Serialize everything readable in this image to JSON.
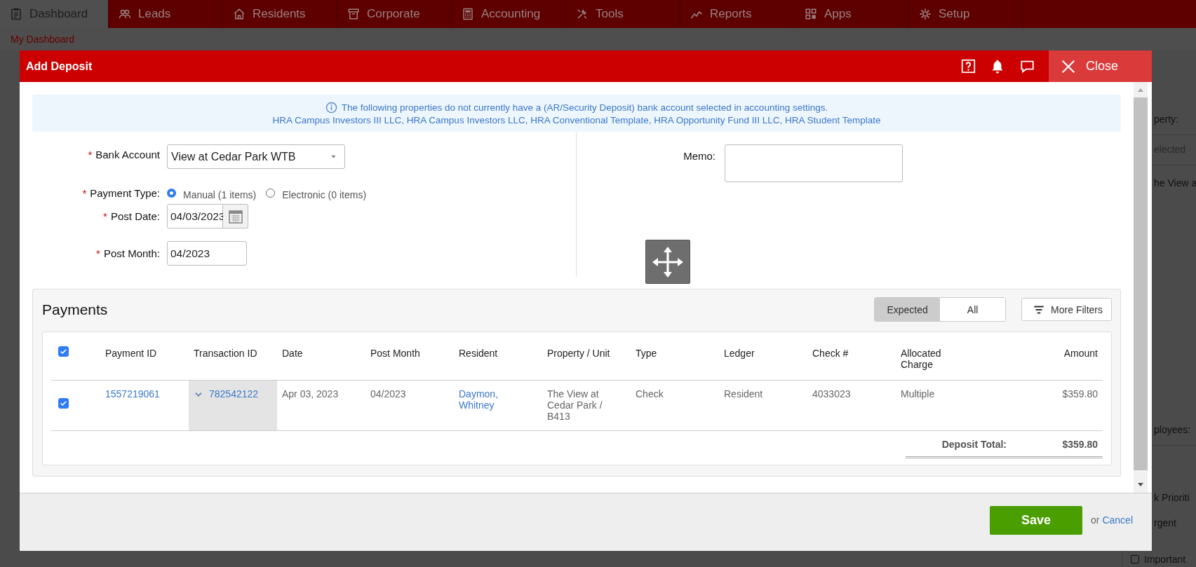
{
  "nav": {
    "tabs": [
      {
        "label": "Dashboard",
        "selected": true
      },
      {
        "label": "Leads",
        "selected": false
      },
      {
        "label": "Residents",
        "selected": false
      },
      {
        "label": "Corporate",
        "selected": false
      },
      {
        "label": "Accounting",
        "selected": false
      },
      {
        "label": "Tools",
        "selected": false
      },
      {
        "label": "Reports",
        "selected": false
      },
      {
        "label": "Apps",
        "selected": false
      },
      {
        "label": "Setup",
        "selected": false
      }
    ]
  },
  "breadcrumb": "My Dashboard",
  "background_panel": {
    "texts": [
      "perty:",
      "elected",
      "he View a",
      "ployees:",
      "k Prioriti",
      "rgent"
    ],
    "checkbox": {
      "label": "Important",
      "checked": false
    }
  },
  "dialog": {
    "title": "Add Deposit",
    "close_label": "Close",
    "notice": [
      "The following properties do not currently have a (AR/Security Deposit) bank account selected in accounting settings.",
      "HRA Campus Investors III LLC, HRA Campus Investors LLC, HRA Conventional Template, HRA Opportunity Fund III LLC, HRA Student Template"
    ],
    "form": {
      "bank_account": {
        "mark": "*",
        "label": "Bank Account",
        "value": "View at Cedar Park WTB"
      },
      "payment_type": {
        "mark": "*",
        "label": "Payment Type:",
        "options": [
          {
            "label": "Manual (1 items)",
            "selected": true
          },
          {
            "label": "Electronic (0 items)",
            "selected": false
          }
        ]
      },
      "post_date": {
        "mark": "*",
        "label": "Post Date:",
        "value": "04/03/2023"
      },
      "post_month": {
        "mark": "*",
        "label": "Post Month:",
        "value": "04/2023"
      },
      "memo": {
        "label": "Memo:"
      }
    },
    "payments": {
      "title": "Payments",
      "view_toggle": [
        {
          "label": "Expected",
          "selected": true
        },
        {
          "label": "All",
          "selected": false
        }
      ],
      "filters_button": "More Filters",
      "all_checked": true,
      "columns": [
        "Payment ID",
        "Transaction ID",
        "Date",
        "Post Month",
        "Resident",
        "Property / Unit",
        "Type",
        "Ledger",
        "Check #",
        "Allocated Charge",
        "Amount"
      ],
      "rows": [
        {
          "checked": true,
          "cells": [
            "1557219061",
            "782542122",
            "Apr 03, 2023",
            "04/2023",
            "Daymon, Whitney",
            "The View at Cedar Park / B413",
            "Check",
            "Resident",
            "4033023",
            "Multiple",
            "$359.80"
          ]
        }
      ],
      "total_label": "Deposit Total:",
      "total": "$359.80"
    },
    "footer": {
      "save": "Save",
      "or": "or",
      "cancel": "Cancel"
    }
  }
}
